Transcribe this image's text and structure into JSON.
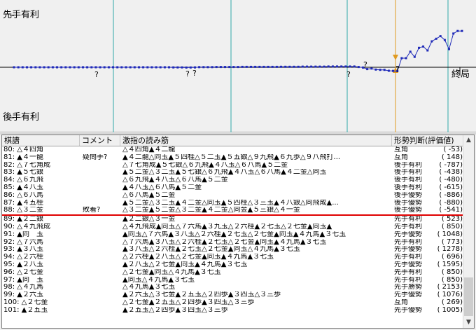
{
  "graph": {
    "label_top": "先手有利",
    "label_bottom": "後手有利",
    "label_end": "終局",
    "chart_data": {
      "type": "line",
      "series": [
        {
          "values": [
            0,
            0,
            0,
            0,
            0,
            0,
            0,
            0,
            0,
            0,
            0,
            0,
            0,
            0,
            0,
            0,
            0,
            0,
            0,
            0,
            0,
            0,
            0,
            0,
            0,
            0,
            0,
            0,
            0,
            0,
            0,
            0,
            0,
            0,
            0,
            0,
            0,
            -6,
            -6,
            -6,
            -10,
            -8,
            -5,
            5,
            5,
            5,
            5,
            10,
            10,
            10,
            10,
            10,
            10,
            15,
            15,
            15,
            15,
            15,
            15,
            15,
            15,
            15,
            20,
            20,
            20,
            20,
            20,
            25,
            25,
            25,
            25,
            25,
            25,
            30,
            30,
            30,
            30,
            30,
            30,
            30,
            10,
            -10,
            -70,
            -50,
            -90,
            -100,
            -100,
            -135,
            -140,
            -149,
            350,
            350,
            600,
            400,
            750,
            800,
            650,
            1000,
            1100,
            1200,
            1050,
            700,
            1300,
            1400,
            1400
          ]
        }
      ],
      "ylim": [
        -2000,
        2000
      ],
      "marks": [
        "?",
        "?",
        "?",
        "?",
        "?",
        "?"
      ]
    }
  },
  "list": {
    "headers": {
      "move": "棋譜",
      "comment": "コメント",
      "line": "激指の読み筋",
      "judge": "形勢判断",
      "eval": "(評価値)"
    },
    "rows": [
      {
        "move": "80: △４四角",
        "comment": "",
        "line": "△４四角▲４二龍",
        "judge": "互角",
        "eval": "(    -53)"
      },
      {
        "move": "81: ▲４一龍",
        "comment": "疑問手?",
        "line": "▲４二龍△同玉▲５四桂△５二玉▲５五銀△９九飛▲６九歩△９八飛打...",
        "judge": "互角",
        "eval": "(    148)"
      },
      {
        "move": "82: △７七角成",
        "comment": "",
        "line": "△７七角成▲５七銀△６九飛▲４八玉△６八馬▲５二金",
        "judge": "後手有利",
        "eval": "(   -787)"
      },
      {
        "move": "83: ▲５七銀",
        "comment": "",
        "line": "▲５二金△３二玉▲５七銀△６九飛▲４八玉△６八馬▲４二金△同玉",
        "judge": "後手有利",
        "eval": "(   -438)"
      },
      {
        "move": "84: △６九飛",
        "comment": "",
        "line": "△６九飛▲４八玉△６八馬▲５二金",
        "judge": "後手有利",
        "eval": "(   -480)"
      },
      {
        "move": "85: ▲４八玉",
        "comment": "",
        "line": "▲４八玉△６八馬▲５二金",
        "judge": "後手有利",
        "eval": "(   -615)"
      },
      {
        "move": "86: △６八馬",
        "comment": "",
        "line": "△６八馬▲５二金",
        "judge": "後手優勢",
        "eval": "(   -886)"
      },
      {
        "move": "87: ▲４五桂",
        "comment": "",
        "line": "▲５二金△３二玉▲４二金△同玉▲５四桂△３三玉▲４八銀△同飛成▲...",
        "judge": "後手優勢",
        "eval": "(   -880)"
      },
      {
        "move": "88: △３二金",
        "comment": "敗着?",
        "line": "△３二金▲５二金△３二金▲４二金△同金▲５三銀△４一金",
        "judge": "後手優勢",
        "eval": "(   -541)"
      },
      {
        "move": "89: ▲２二銀",
        "comment": "",
        "line": "▲２二銀△３一金",
        "judge": "先手有利",
        "eval": "(    523)"
      },
      {
        "move": "90: △４九飛成",
        "comment": "",
        "line": "△４九飛成▲同玉△７六馬▲３九玉△２六桂▲２七玉△２七金▲同玉▲",
        "judge": "先手有利",
        "eval": "(    850)"
      },
      {
        "move": "91: ▲同　玉",
        "comment": "",
        "line": "▲同玉△７六馬▲３八玉△２六桂▲２七玉△２七金▲同玉▲４九馬▲３七玉",
        "judge": "先手優勢",
        "eval": "(   1048)"
      },
      {
        "move": "92: △７六馬",
        "comment": "",
        "line": "△７六馬▲３八玉△２六桂▲２七玉△２七金▲同玉▲４九馬▲３七玉",
        "judge": "先手有利",
        "eval": "(    773)"
      },
      {
        "move": "93: ▲３八玉",
        "comment": "",
        "line": "▲３八玉△２六桂▲２七玉△２七金▲同玉△４九馬▲３七玉",
        "judge": "先手優勢",
        "eval": "(   1278)"
      },
      {
        "move": "94: △２六桂",
        "comment": "",
        "line": "△２六桂▲２八玉△２七金▲同玉▲４九馬▲３七玉",
        "judge": "先手有利",
        "eval": "(    696)"
      },
      {
        "move": "95: ▲２八玉",
        "comment": "",
        "line": "▲２八玉△２七金▲同玉▲４九馬▲３七玉",
        "judge": "先手優勢",
        "eval": "(   1595)"
      },
      {
        "move": "96: △２七金",
        "comment": "",
        "line": "△２七金▲同玉△４九馬▲３七玉",
        "judge": "先手有利",
        "eval": "(    850)"
      },
      {
        "move": "97: ▲同　玉",
        "comment": "",
        "line": "▲同玉△４九馬▲３七玉",
        "judge": "先手有利",
        "eval": "(    850)"
      },
      {
        "move": "98: △４九馬",
        "comment": "",
        "line": "△４九馬▲３七玉",
        "judge": "先手勝勢",
        "eval": "(   2153)"
      },
      {
        "move": "99: ▲２六玉",
        "comment": "",
        "line": "▲２六玉△３七金▲２五玉△２四歩▲３四玉△３三歩",
        "judge": "先手優勢",
        "eval": "(   1076)"
      },
      {
        "move": "100: △２七金",
        "comment": "",
        "line": "△２七金▲２五玉△２四歩▲３四玉△３三歩",
        "judge": "互角",
        "eval": "(    269)"
      },
      {
        "move": "101: ▲２五玉",
        "comment": "",
        "line": "▲２五玉△２四歩▲３四玉△３三歩",
        "judge": "先手優勢",
        "eval": "(   1005)"
      }
    ]
  }
}
